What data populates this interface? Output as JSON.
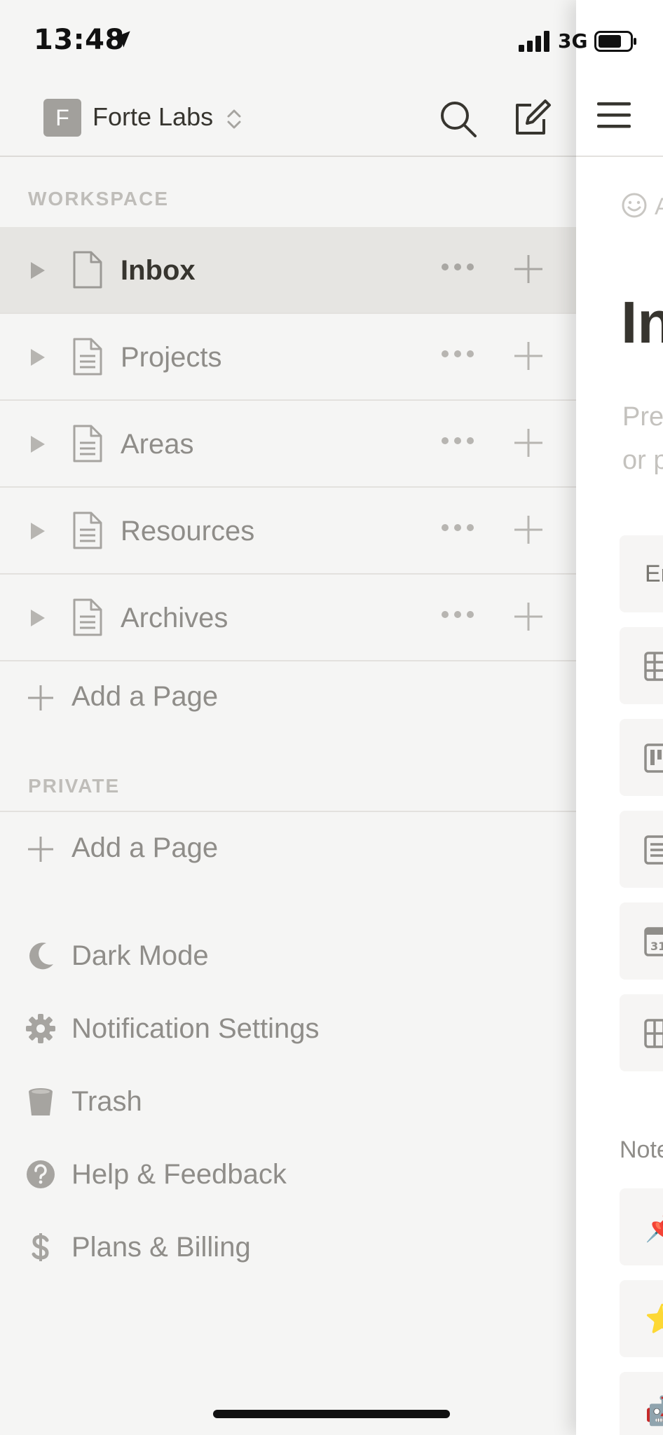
{
  "status_bar": {
    "time": "13:48",
    "network": "3G"
  },
  "workspace": {
    "initial": "F",
    "name": "Forte Labs"
  },
  "sections": {
    "workspace_label": "WORKSPACE",
    "private_label": "PRIVATE"
  },
  "pages": [
    {
      "label": "Inbox",
      "selected": true
    },
    {
      "label": "Projects"
    },
    {
      "label": "Areas"
    },
    {
      "label": "Resources"
    },
    {
      "label": "Archives"
    }
  ],
  "add_page_label": "Add a Page",
  "private_add_page_label": "Add a Page",
  "menu": [
    {
      "label": "Dark Mode",
      "icon": "moon-icon"
    },
    {
      "label": "Notification Settings",
      "icon": "gear-icon"
    },
    {
      "label": "Trash",
      "icon": "trash-icon"
    },
    {
      "label": "Help & Feedback",
      "icon": "help-icon"
    },
    {
      "label": "Plans & Billing",
      "icon": "dollar-icon"
    }
  ],
  "content_panel": {
    "add_icon_text": "A",
    "title_text": "In",
    "desc_line1": "Pre",
    "desc_line2": "or p",
    "card_text": "Er",
    "notes_label": "Note",
    "emoji": [
      "📌",
      "⭐",
      "🤖"
    ]
  },
  "colors": {
    "sidebar_bg": "#f5f5f4",
    "selected_row_bg": "#e6e5e2",
    "text_primary": "#37352f",
    "text_muted": "#8f8d89"
  }
}
